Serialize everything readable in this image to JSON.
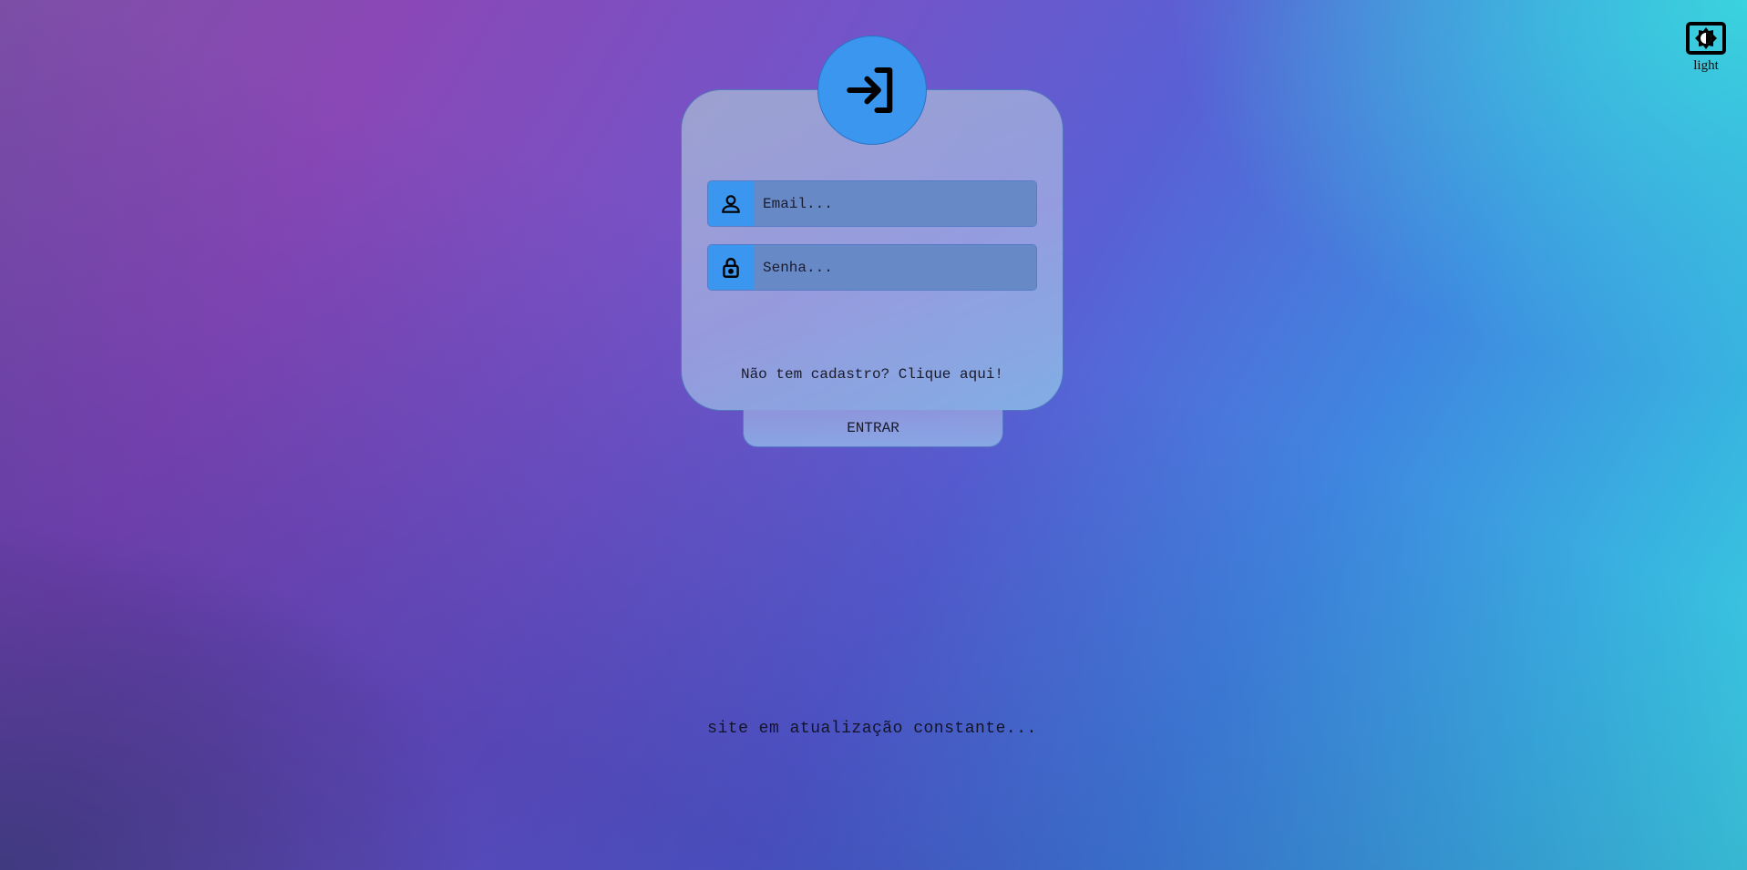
{
  "theme_toggle": {
    "icon": "brightness-contrast-icon",
    "label": "light"
  },
  "login": {
    "header_icon": "login-enter-icon",
    "email": {
      "icon": "user-icon",
      "placeholder": "Email...",
      "value": ""
    },
    "password": {
      "icon": "lock-icon",
      "placeholder": "Senha...",
      "value": ""
    },
    "signup_text": "Não tem cadastro? Clique aqui!",
    "submit_label": "ENTRAR"
  },
  "footer": {
    "note": "site em atualização constante..."
  },
  "colors": {
    "accent": "#3a96ee",
    "input_bg": "#6789c6",
    "text": "#1a1a2a"
  }
}
